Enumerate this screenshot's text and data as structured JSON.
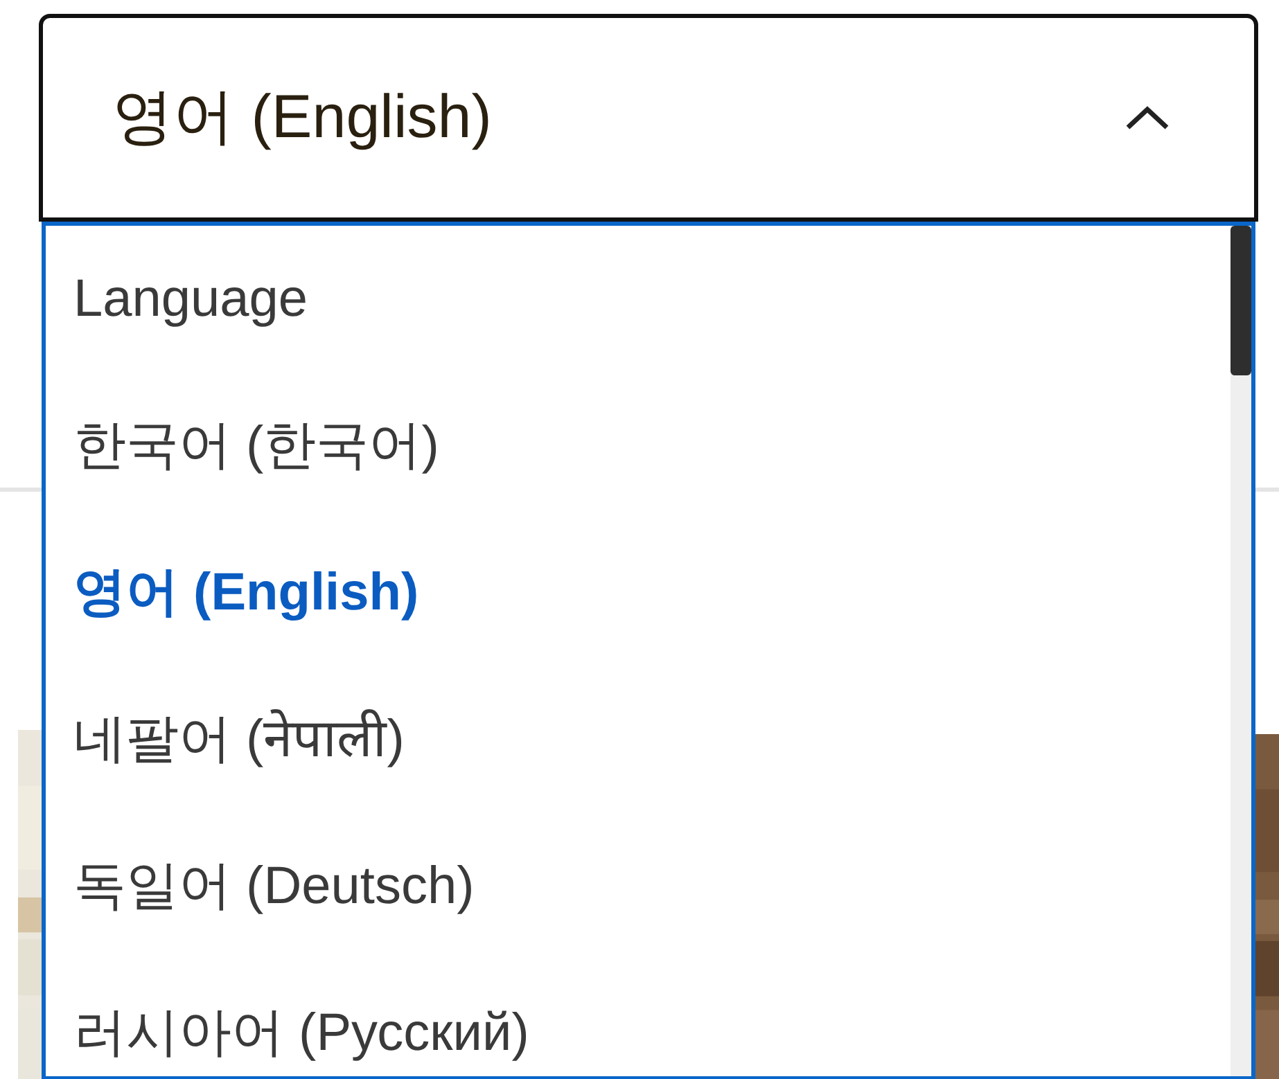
{
  "select": {
    "value": "영어 (English)",
    "expanded": true
  },
  "options": [
    {
      "label": "Language",
      "selected": false
    },
    {
      "label": "한국어 (한국어)",
      "selected": false
    },
    {
      "label": "영어 (English)",
      "selected": true
    },
    {
      "label": "네팔어 (नेपाली)",
      "selected": false
    },
    {
      "label": "독일어 (Deutsch)",
      "selected": false
    },
    {
      "label": "러시아어 (Русский)",
      "selected": false
    }
  ]
}
